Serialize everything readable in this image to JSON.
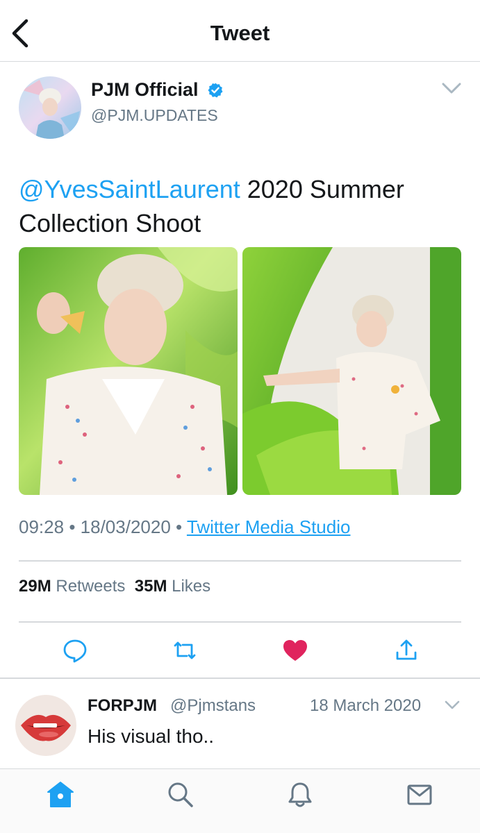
{
  "header": {
    "title": "Tweet",
    "back_icon": "chevron-left-icon"
  },
  "tweet": {
    "author_name": "PJM Official",
    "author_handle": "@PJM.UPDATES",
    "verified": true,
    "mention": "@YvesSaintLaurent",
    "text_rest": " 2020 Summer Collection Shoot",
    "time": "09:28",
    "separator": "•",
    "date": "18/03/2020",
    "source": "Twitter Media Studio",
    "retweets_count": "29M",
    "retweets_label": "Retweets",
    "likes_count": "35M",
    "likes_label": "Likes",
    "liked": true
  },
  "actions": [
    "reply-icon",
    "retweet-icon",
    "like-icon",
    "share-icon"
  ],
  "reply": {
    "name": "FORPJM",
    "handle": "@Pjmstans",
    "date": "18 March 2020",
    "text": "His visual tho.."
  },
  "bottom_nav": [
    "home-icon",
    "search-icon",
    "notifications-icon",
    "messages-icon"
  ],
  "colors": {
    "accent": "#1da1f2",
    "like": "#e0245e",
    "muted": "#657786",
    "text": "#14171a"
  }
}
